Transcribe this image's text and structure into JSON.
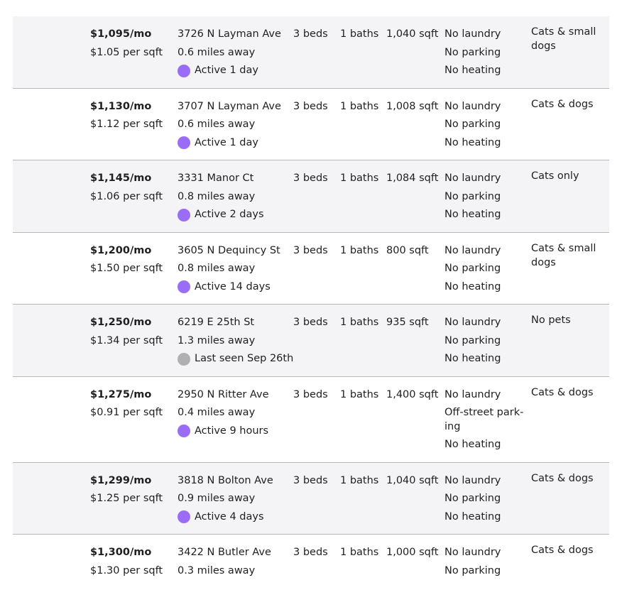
{
  "colors": {
    "active_dot": "#9b6cf5",
    "inactive_dot": "#b0b0b0",
    "row_shade": "#f4f4f7",
    "divider": "#b8b8b8"
  },
  "listings": [
    {
      "price": "$1,095/mo",
      "per_sqft": "$1.05 per sqft",
      "address": "3726 N Layman Ave",
      "distance": "0.6 miles away",
      "status": "Active 1 day",
      "status_type": "active",
      "beds": "3 beds",
      "baths": "1 baths",
      "sqft": "1,040 sqft",
      "laundry": "No laundry",
      "parking": "No parking",
      "heating": "No heating",
      "pets": "Cats & small dogs"
    },
    {
      "price": "$1,130/mo",
      "per_sqft": "$1.12 per sqft",
      "address": "3707 N Layman Ave",
      "distance": "0.6 miles away",
      "status": "Active 1 day",
      "status_type": "active",
      "beds": "3 beds",
      "baths": "1 baths",
      "sqft": "1,008 sqft",
      "laundry": "No laundry",
      "parking": "No parking",
      "heating": "No heating",
      "pets": "Cats & dogs"
    },
    {
      "price": "$1,145/mo",
      "per_sqft": "$1.06 per sqft",
      "address": "3331 Manor Ct",
      "distance": "0.8 miles away",
      "status": "Active 2 days",
      "status_type": "active",
      "beds": "3 beds",
      "baths": "1 baths",
      "sqft": "1,084 sqft",
      "laundry": "No laundry",
      "parking": "No parking",
      "heating": "No heating",
      "pets": "Cats only"
    },
    {
      "price": "$1,200/mo",
      "per_sqft": "$1.50 per sqft",
      "address": "3605 N Dequincy St",
      "distance": "0.8 miles away",
      "status": "Active 14 days",
      "status_type": "active",
      "beds": "3 beds",
      "baths": "1 baths",
      "sqft": "800 sqft",
      "laundry": "No laundry",
      "parking": "No parking",
      "heating": "No heating",
      "pets": "Cats & small dogs"
    },
    {
      "price": "$1,250/mo",
      "per_sqft": "$1.34 per sqft",
      "address": "6219 E 25th St",
      "distance": "1.3 miles away",
      "status": "Last seen Sep 26th",
      "status_type": "inactive",
      "beds": "3 beds",
      "baths": "1 baths",
      "sqft": "935 sqft",
      "laundry": "No laundry",
      "parking": "No parking",
      "heating": "No heating",
      "pets": "No pets"
    },
    {
      "price": "$1,275/mo",
      "per_sqft": "$0.91 per sqft",
      "address": "2950 N Ritter Ave",
      "distance": "0.4 miles away",
      "status": "Active 9 hours",
      "status_type": "active",
      "beds": "3 beds",
      "baths": "1 baths",
      "sqft": "1,400 sqft",
      "laundry": "No laundry",
      "parking": "Off-street park-ing",
      "heating": "No heating",
      "pets": "Cats & dogs"
    },
    {
      "price": "$1,299/mo",
      "per_sqft": "$1.25 per sqft",
      "address": "3818 N Bolton Ave",
      "distance": "0.9 miles away",
      "status": "Active 4 days",
      "status_type": "active",
      "beds": "3 beds",
      "baths": "1 baths",
      "sqft": "1,040 sqft",
      "laundry": "No laundry",
      "parking": "No parking",
      "heating": "No heating",
      "pets": "Cats & dogs"
    },
    {
      "price": "$1,300/mo",
      "per_sqft": "$1.30 per sqft",
      "address": "3422 N Butler Ave",
      "distance": "0.3 miles away",
      "status": "",
      "status_type": "active",
      "beds": "3 beds",
      "baths": "1 baths",
      "sqft": "1,000 sqft",
      "laundry": "No laundry",
      "parking": "No parking",
      "heating": "",
      "pets": "Cats & dogs"
    }
  ]
}
